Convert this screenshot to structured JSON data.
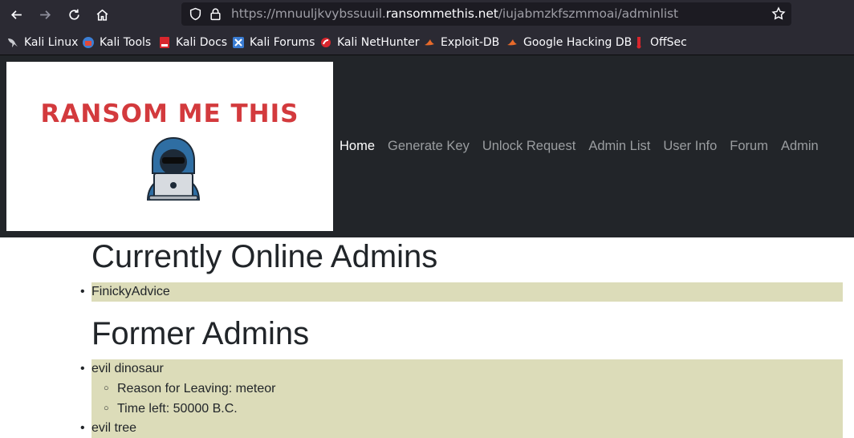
{
  "browser": {
    "url_prefix": "https://mnuuljkvybssuuil.",
    "url_host": "ransommethis.net",
    "url_path": "/iujabmzkfszmmoai/adminlist",
    "bookmarks": [
      {
        "label": "Kali Linux",
        "icon": "kali-dragon-icon"
      },
      {
        "label": "Kali Tools",
        "icon": "kali-tools-icon"
      },
      {
        "label": "Kali Docs",
        "icon": "kali-docs-icon"
      },
      {
        "label": "Kali Forums",
        "icon": "kali-forums-icon"
      },
      {
        "label": "Kali NetHunter",
        "icon": "nethunter-icon"
      },
      {
        "label": "Exploit-DB",
        "icon": "exploit-db-icon"
      },
      {
        "label": "Google Hacking DB",
        "icon": "ghdb-icon"
      },
      {
        "label": "OffSec",
        "icon": "offsec-icon"
      }
    ]
  },
  "site": {
    "logo_text": "RANSOM ME THIS",
    "nav": [
      {
        "label": "Home",
        "active": true
      },
      {
        "label": "Generate Key",
        "active": false
      },
      {
        "label": "Unlock Request",
        "active": false
      },
      {
        "label": "Admin List",
        "active": false
      },
      {
        "label": "User Info",
        "active": false
      },
      {
        "label": "Forum",
        "active": false
      },
      {
        "label": "Admin",
        "active": false
      }
    ]
  },
  "online": {
    "heading": "Currently Online Admins",
    "admins": [
      "FinickyAdvice"
    ]
  },
  "former": {
    "heading": "Former Admins",
    "admins": [
      {
        "name": "evil dinosaur",
        "details": [
          "Reason for Leaving: meteor",
          "Time left: 50000 B.C."
        ]
      },
      {
        "name": "evil tree",
        "details": []
      }
    ]
  },
  "colors": {
    "header_bg": "#222529",
    "list_highlight": "#dcdcb9",
    "logo_red": "#d33a3d",
    "browser_bg": "#2b2a33"
  }
}
